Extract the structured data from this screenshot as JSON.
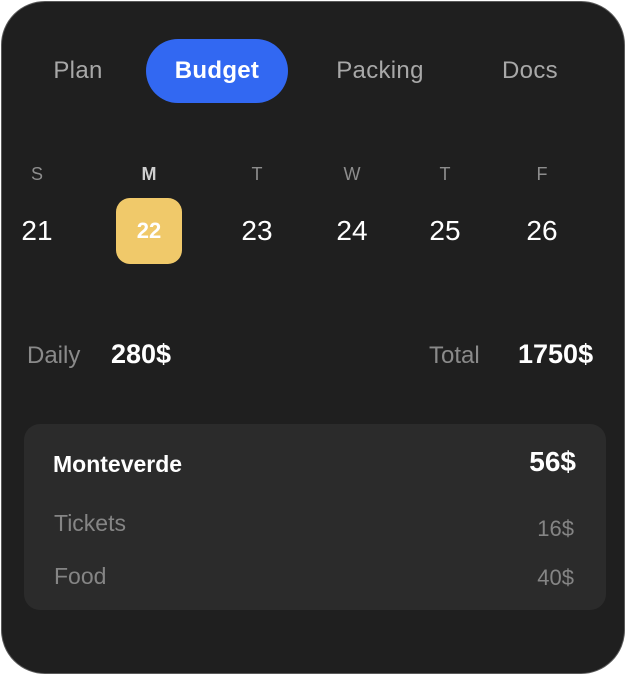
{
  "tabs": [
    {
      "label": "Plan",
      "active": false
    },
    {
      "label": "Budget",
      "active": true
    },
    {
      "label": "Packing",
      "active": false
    },
    {
      "label": "Docs",
      "active": false
    }
  ],
  "days": [
    {
      "letter": "S",
      "number": "21",
      "selected": false
    },
    {
      "letter": "M",
      "number": "22",
      "selected": true
    },
    {
      "letter": "T",
      "number": "23",
      "selected": false
    },
    {
      "letter": "W",
      "number": "24",
      "selected": false
    },
    {
      "letter": "T",
      "number": "25",
      "selected": false
    },
    {
      "letter": "F",
      "number": "26",
      "selected": false
    }
  ],
  "summary": {
    "daily_label": "Daily",
    "daily_value": "280$",
    "total_label": "Total",
    "total_value": "1750$"
  },
  "location": {
    "name": "Monteverde",
    "total": "56$",
    "items": [
      {
        "label": "Tickets",
        "value": "16$"
      },
      {
        "label": "Food",
        "value": "40$"
      }
    ]
  },
  "colors": {
    "background": "#1f1f1f",
    "active_tab": "#3268f2",
    "selected_day": "#f0c96a",
    "panel": "#2b2b2b"
  }
}
